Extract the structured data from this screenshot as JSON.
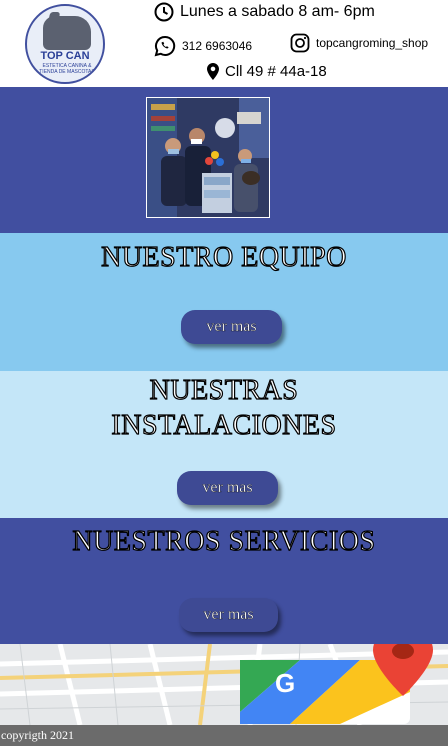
{
  "header": {
    "logo": {
      "brand": "TOP CAN",
      "subtitle": "ESTETICA CANINA & TIENDA DE MASCOTAS"
    },
    "hours": "Lunes a sabado 8 am- 6pm",
    "phone": "312 6963046",
    "instagram": "topcangroming_shop",
    "address": "Cll 49 # 44a-18"
  },
  "sections": {
    "team": {
      "title": "NUESTRO EQUIPO",
      "button": "ver mas"
    },
    "facilities": {
      "title_line1": "NUESTRAS",
      "title_line2": "INSTALACIONES",
      "button": "ver mas"
    },
    "services": {
      "title": "NUESTROS SERVICIOS",
      "button": "ver mas"
    }
  },
  "footer": {
    "copyright": "copyrigth 2021"
  },
  "colors": {
    "dark_blue": "#414fa0",
    "light_blue": "#87c9ef",
    "pale_blue": "#c4e6f8",
    "footer_gray": "#6b6b6b"
  }
}
